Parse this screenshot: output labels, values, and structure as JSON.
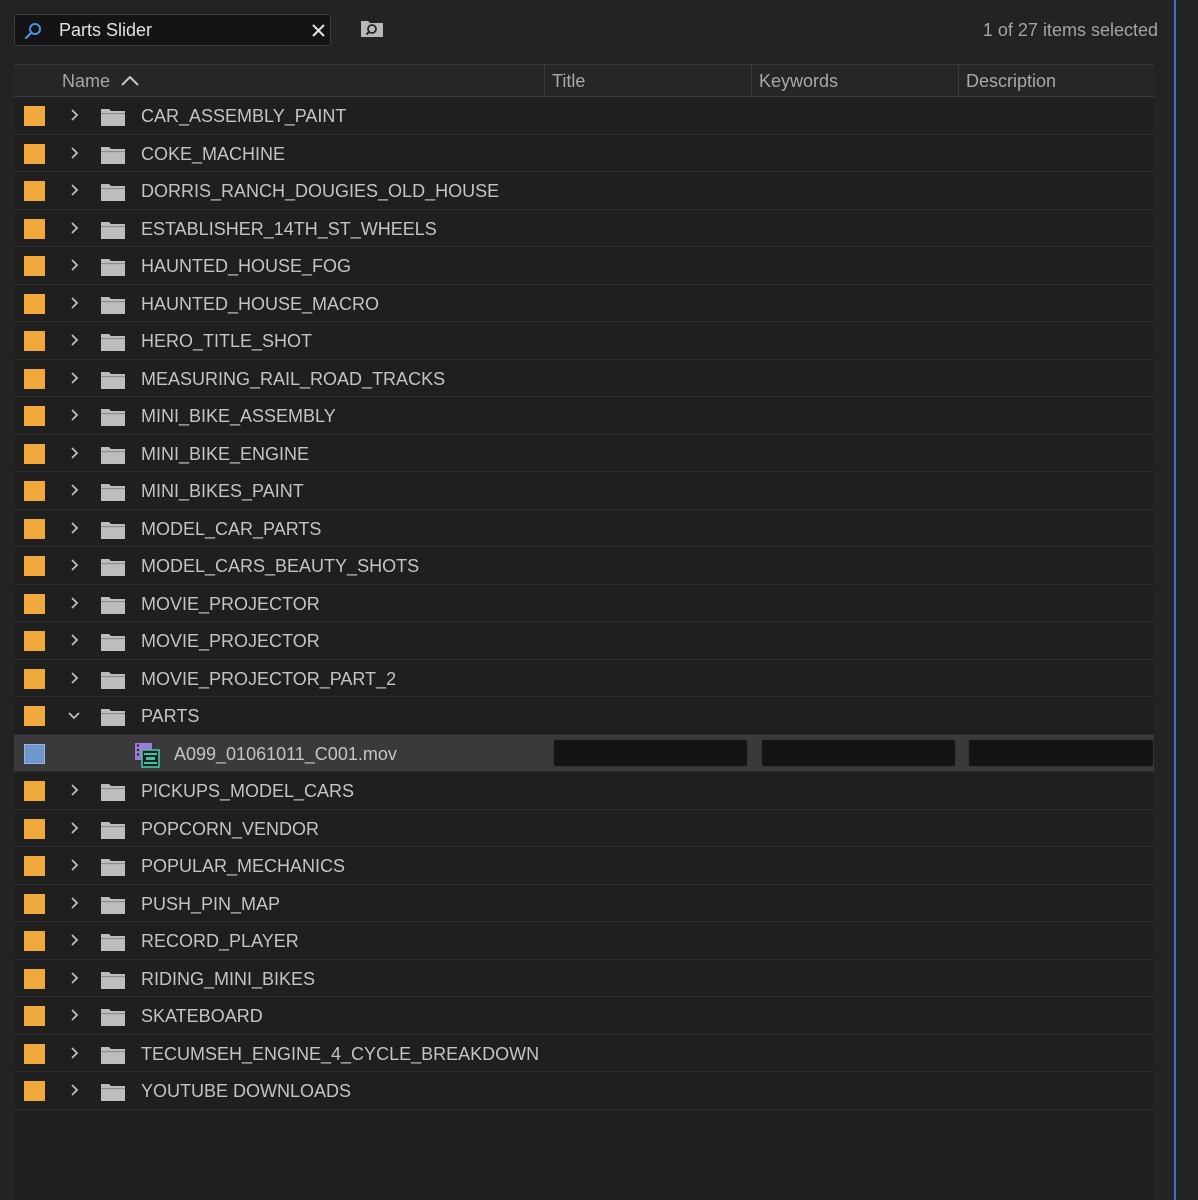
{
  "search": {
    "query": "Parts Slider",
    "placeholder": ""
  },
  "status": {
    "selection_count": "1 of 27 items selected"
  },
  "columns": [
    {
      "label": "Name",
      "sorted": "ascending"
    },
    {
      "label": "Title"
    },
    {
      "label": "Keywords"
    },
    {
      "label": "Description"
    }
  ],
  "items": [
    {
      "label": "CAR_ASSEMBLY_PAINT",
      "type": "bin",
      "expanded": false
    },
    {
      "label": "COKE_MACHINE",
      "type": "bin",
      "expanded": false
    },
    {
      "label": "DORRIS_RANCH_DOUGIES_OLD_HOUSE",
      "type": "bin",
      "expanded": false
    },
    {
      "label": "ESTABLISHER_14TH_ST_WHEELS",
      "type": "bin",
      "expanded": false
    },
    {
      "label": "HAUNTED_HOUSE_FOG",
      "type": "bin",
      "expanded": false
    },
    {
      "label": "HAUNTED_HOUSE_MACRO",
      "type": "bin",
      "expanded": false
    },
    {
      "label": "HERO_TITLE_SHOT",
      "type": "bin",
      "expanded": false
    },
    {
      "label": "MEASURING_RAIL_ROAD_TRACKS",
      "type": "bin",
      "expanded": false
    },
    {
      "label": "MINI_BIKE_ASSEMBLY",
      "type": "bin",
      "expanded": false
    },
    {
      "label": "MINI_BIKE_ENGINE",
      "type": "bin",
      "expanded": false
    },
    {
      "label": "MINI_BIKES_PAINT",
      "type": "bin",
      "expanded": false
    },
    {
      "label": "MODEL_CAR_PARTS",
      "type": "bin",
      "expanded": false
    },
    {
      "label": "MODEL_CARS_BEAUTY_SHOTS",
      "type": "bin",
      "expanded": false
    },
    {
      "label": "MOVIE_PROJECTOR",
      "type": "bin",
      "expanded": false
    },
    {
      "label": "MOVIE_PROJECTOR",
      "type": "bin",
      "expanded": false
    },
    {
      "label": "MOVIE_PROJECTOR_PART_2",
      "type": "bin",
      "expanded": false
    },
    {
      "label": "PARTS",
      "type": "bin",
      "expanded": true
    },
    {
      "label": "A099_01061011_C001.mov",
      "type": "clip",
      "selected": true,
      "title": "",
      "keywords": "",
      "description": ""
    },
    {
      "label": "PICKUPS_MODEL_CARS",
      "type": "bin",
      "expanded": false
    },
    {
      "label": "POPCORN_VENDOR",
      "type": "bin",
      "expanded": false
    },
    {
      "label": "POPULAR_MECHANICS",
      "type": "bin",
      "expanded": false
    },
    {
      "label": "PUSH_PIN_MAP",
      "type": "bin",
      "expanded": false
    },
    {
      "label": "RECORD_PLAYER",
      "type": "bin",
      "expanded": false
    },
    {
      "label": "RIDING_MINI_BIKES",
      "type": "bin",
      "expanded": false
    },
    {
      "label": "SKATEBOARD",
      "type": "bin",
      "expanded": false
    },
    {
      "label": "TECUMSEH_ENGINE_4_CYCLE_BREAKDOWN",
      "type": "bin",
      "expanded": false
    },
    {
      "label": "YOUTUBE DOWNLOADS",
      "type": "bin",
      "expanded": false
    }
  ],
  "colors": {
    "bin_label": "#f2a93b",
    "clip_label": "#6f96cf",
    "focus_line": "#3d6fd6",
    "search_icon": "#4a8fe7"
  },
  "icons": {
    "search": "magnifier-icon",
    "clear": "close-icon",
    "bin_search": "find-bin-icon",
    "folder": "folder-icon",
    "clip": "video-clip-icon"
  }
}
